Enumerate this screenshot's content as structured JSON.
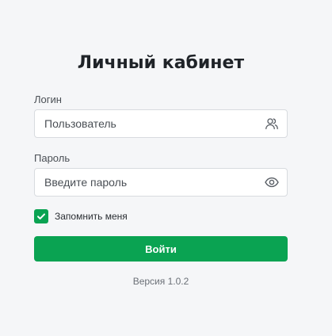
{
  "login": {
    "title": "Личный кабинет",
    "username": {
      "label": "Логин",
      "placeholder": "Пользователь",
      "value": "",
      "icon": "users-icon"
    },
    "password": {
      "label": "Пароль",
      "placeholder": "Введите пароль",
      "value": "",
      "icon": "eye-icon"
    },
    "remember": {
      "label": "Запомнить меня",
      "checked": true
    },
    "submit_label": "Войти",
    "version": "Версия 1.0.2"
  },
  "colors": {
    "accent": "#0aa352",
    "background": "#f5f6f8",
    "input_border": "#d8dbdf"
  }
}
